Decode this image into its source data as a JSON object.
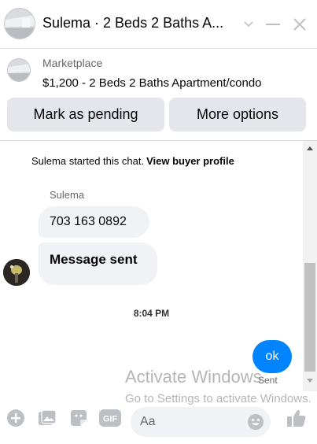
{
  "header": {
    "title": "Sulema · 2 Beds 2 Baths A...",
    "avatar_icon": "listing-photo",
    "chevron_icon": "chevron-down-icon",
    "minimize_icon": "minimize-icon",
    "close_icon": "close-icon"
  },
  "listing": {
    "label": "Marketplace",
    "price_title": "$1,200 - 2 Beds 2 Baths Apartment/condo",
    "actions": [
      "Mark as pending",
      "More options"
    ]
  },
  "chat": {
    "system_note": "Sulema started this chat.",
    "system_link": "View buyer profile",
    "sender_name": "Sulema",
    "messages_in": [
      "703 163 0892",
      "Message sent"
    ],
    "timestamp": "8:04 PM",
    "message_out": "ok",
    "status": "Sent"
  },
  "watermark": {
    "line1": "Activate Windows",
    "line2": "Go to Settings to activate Windows."
  },
  "composer": {
    "placeholder": "Aa",
    "icons": [
      "plus-icon",
      "photo-icon",
      "sticker-icon",
      "gif-icon",
      "emoji-icon",
      "like-icon"
    ]
  },
  "colors": {
    "accent": "#0084ff",
    "bubble_in": "#f0f2f5",
    "button_bg": "#e4e6eb",
    "icon_gray": "#bcc0c4"
  }
}
